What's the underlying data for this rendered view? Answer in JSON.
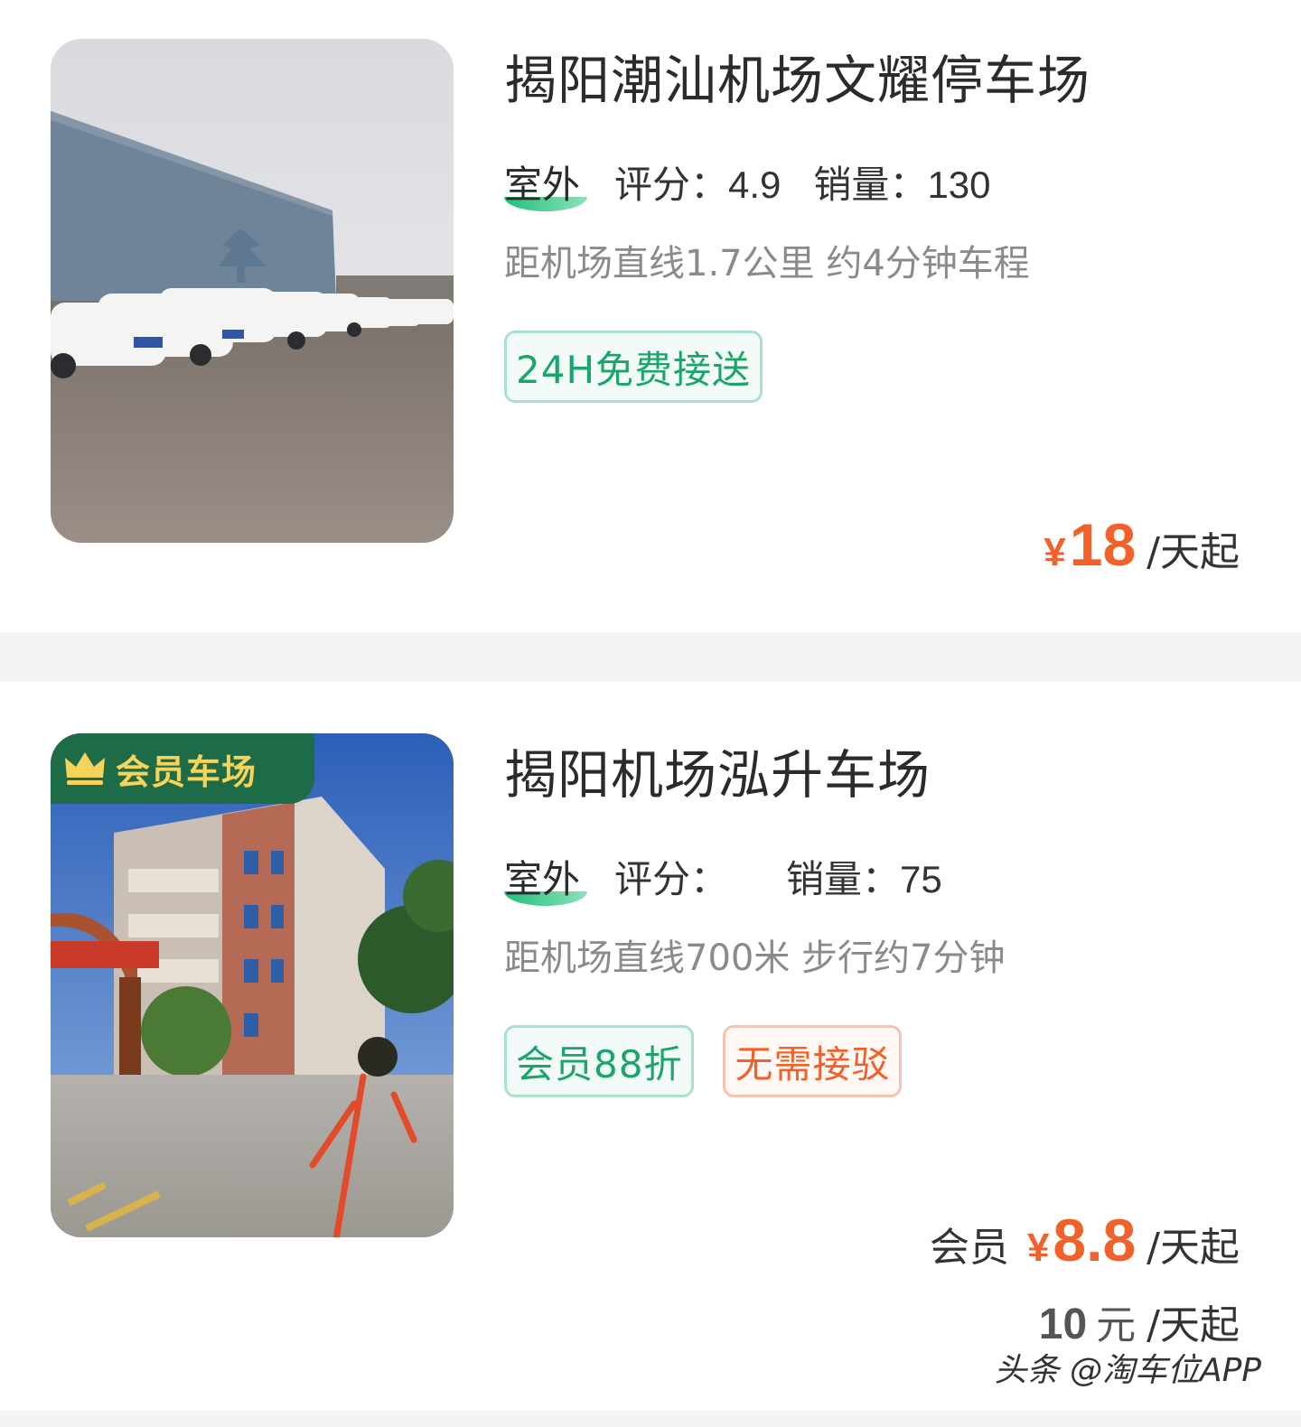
{
  "listings": [
    {
      "title": "揭阳潮汕机场文耀停车场",
      "environment": "室外",
      "rating_label": "评分：",
      "rating_value": "4.9",
      "sales_label": "销量：",
      "sales_value": "130",
      "distance": "距机场直线1.7公里 约4分钟车程",
      "tags": [
        "24H免费接送"
      ],
      "price_currency": "¥",
      "price_value": "18",
      "price_unit": "/天起"
    },
    {
      "badge": "会员车场",
      "title": "揭阳机场泓升车场",
      "environment": "室外",
      "rating_label": "评分：",
      "rating_value": "",
      "sales_label": "销量：",
      "sales_value": "75",
      "distance": "距机场直线700米 步行约7分钟",
      "tags": [
        "会员88折",
        "无需接驳"
      ],
      "member_label": "会员",
      "price_currency": "¥",
      "price_value": "8.8",
      "price_unit": "/天起",
      "regular_price_value": "10",
      "regular_price_yuan": "元",
      "regular_price_unit": "/天起"
    }
  ],
  "watermark": "头条 @淘车位APP",
  "colors": {
    "accent_orange": "#f0622a",
    "tag_green": "#1aa66a",
    "vip_green": "#1e6b47",
    "vip_gold": "#f6d35a"
  },
  "icons": {
    "vip_badge": "crown-icon"
  }
}
